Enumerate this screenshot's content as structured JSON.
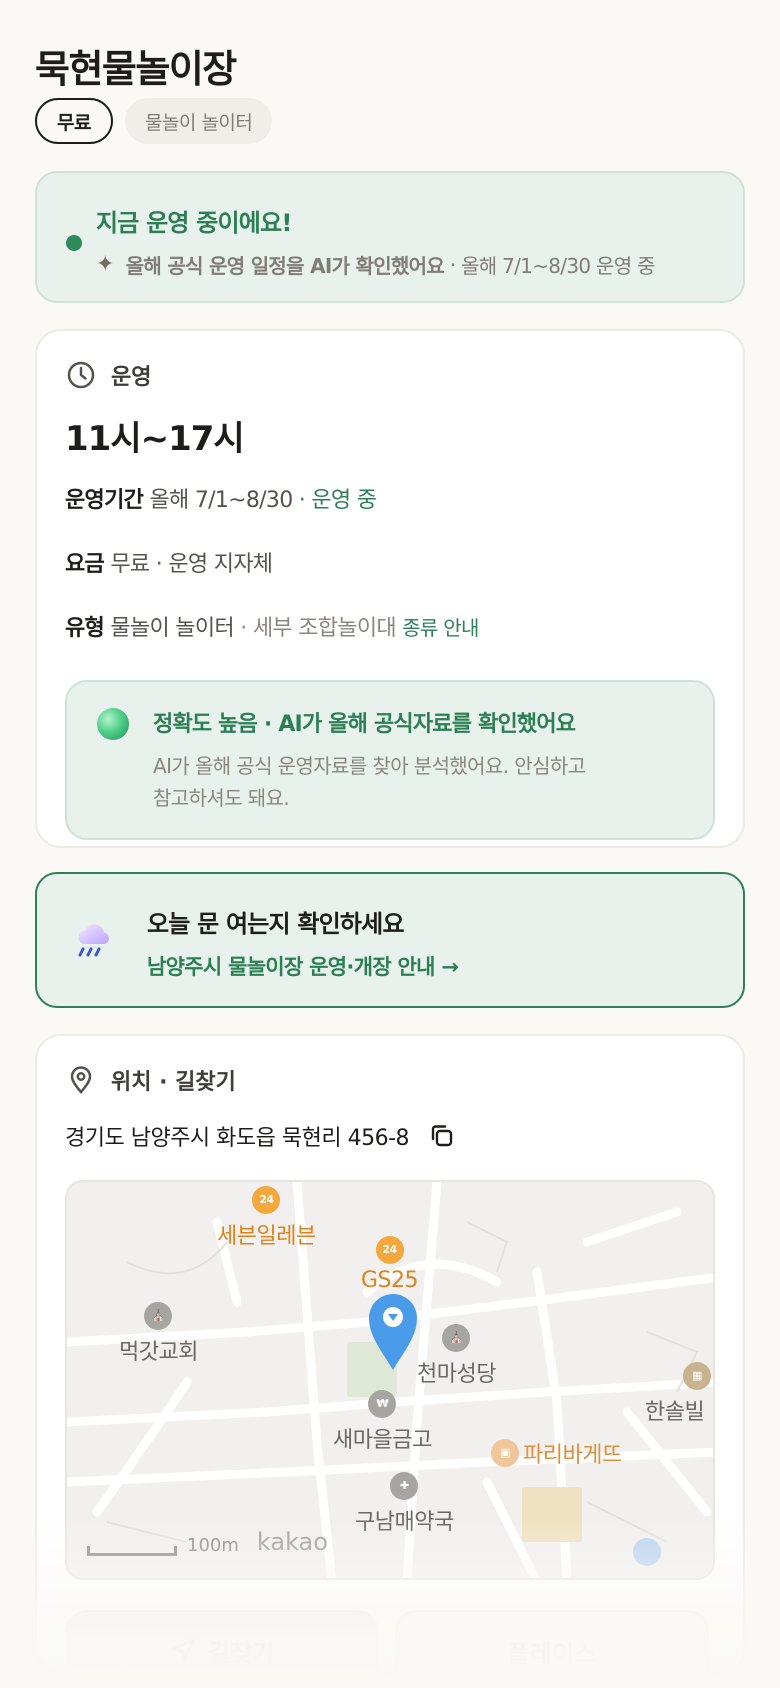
{
  "title": "묵현물놀이장",
  "chips": [
    "무료",
    "물놀이 놀이터"
  ],
  "status": {
    "headline": "지금 운영 중이에요!",
    "ai_note": "올해 공식 운영 일정을 AI가 확인했어요",
    "separator": " · ",
    "period": "올해 7/1~8/30 운영 중"
  },
  "hours": {
    "section": "운영",
    "time": "11시~17시",
    "period_label": "운영기간",
    "period_value": "올해 7/1~8/30",
    "period_status": "· 운영 중",
    "fee_label": "요금",
    "fee_value": "무료 · 운영 지자체",
    "type_label": "유형",
    "type_value": "물놀이 놀이터",
    "type_detail": "· 세부 조합놀이대",
    "type_link": "종류 안내"
  },
  "accuracy": {
    "headline": "정확도 높음 · AI가 올해 공식자료를 확인했어요",
    "desc_line1": "AI가 올해 공식 운영자료를 찾아 분석했어요. 안심하고",
    "desc_line2": "참고하셔도 돼요."
  },
  "cta": {
    "headline": "오늘 문 여는지 확인하세요",
    "link": "남양주시 물놀이장 운영·개장 안내 →"
  },
  "location": {
    "section": "위치 · 길찾기",
    "address": "경기도 남양주시 화도읍 묵현리 456-8",
    "map": {
      "pois": [
        "세븐일레븐",
        "GS25",
        "먹갓교회",
        "천마성당",
        "한솔빌",
        "새마을금고",
        "파리바게뜨",
        "구남매약국"
      ],
      "badge_24": "24",
      "scale": "100m",
      "provider": "kakao"
    }
  },
  "buttons": {
    "directions": "길찾기",
    "place": "플레이스"
  },
  "colors": {
    "accent_green": "#2b7f55",
    "soft_green_bg": "#e8f1ec",
    "page_bg": "#faf9f6",
    "poi_orange": "#e0821c",
    "marker_blue": "#4a9bea"
  }
}
